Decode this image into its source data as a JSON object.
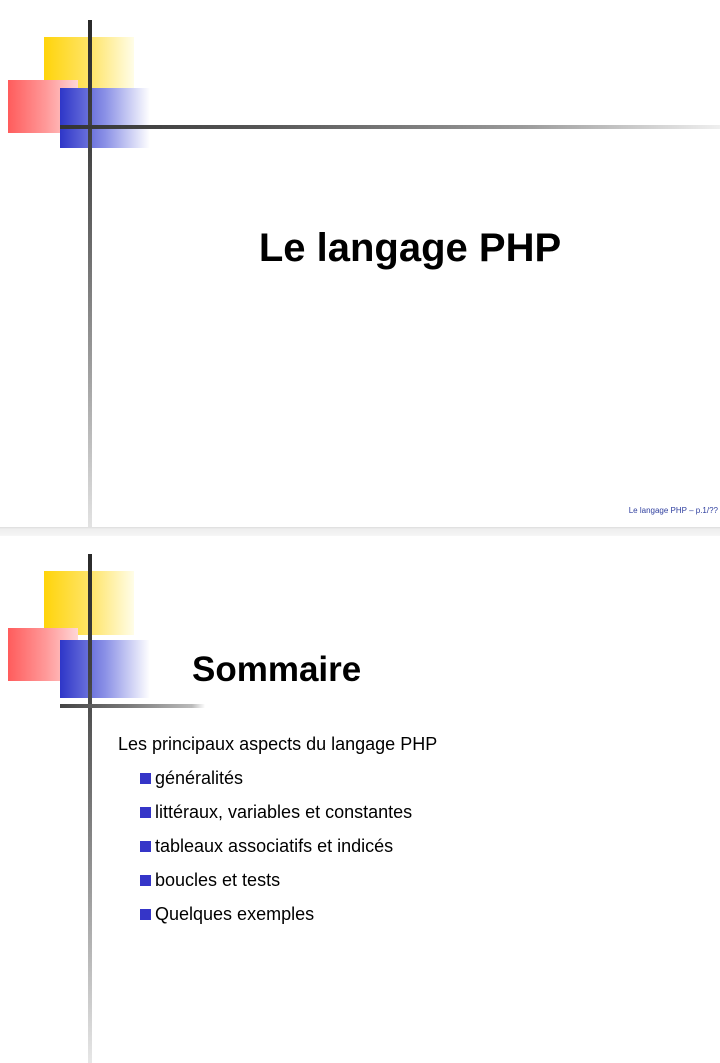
{
  "slides": [
    {
      "title": "Le langage PHP",
      "footer": "Le langage PHP – p.1/??"
    },
    {
      "title": "Sommaire",
      "intro": "Les principaux aspects du langage PHP",
      "items": [
        "généralités",
        "littéraux, variables et constantes",
        "tableaux associatifs et indicés",
        "boucles et tests",
        "Quelques exemples"
      ]
    }
  ],
  "colors": {
    "yellow": "#ffd40a",
    "red": "#ff5c5c",
    "blue": "#2e36c8",
    "bullet": "#3535c8",
    "footer_text": "#2f3f9f"
  }
}
